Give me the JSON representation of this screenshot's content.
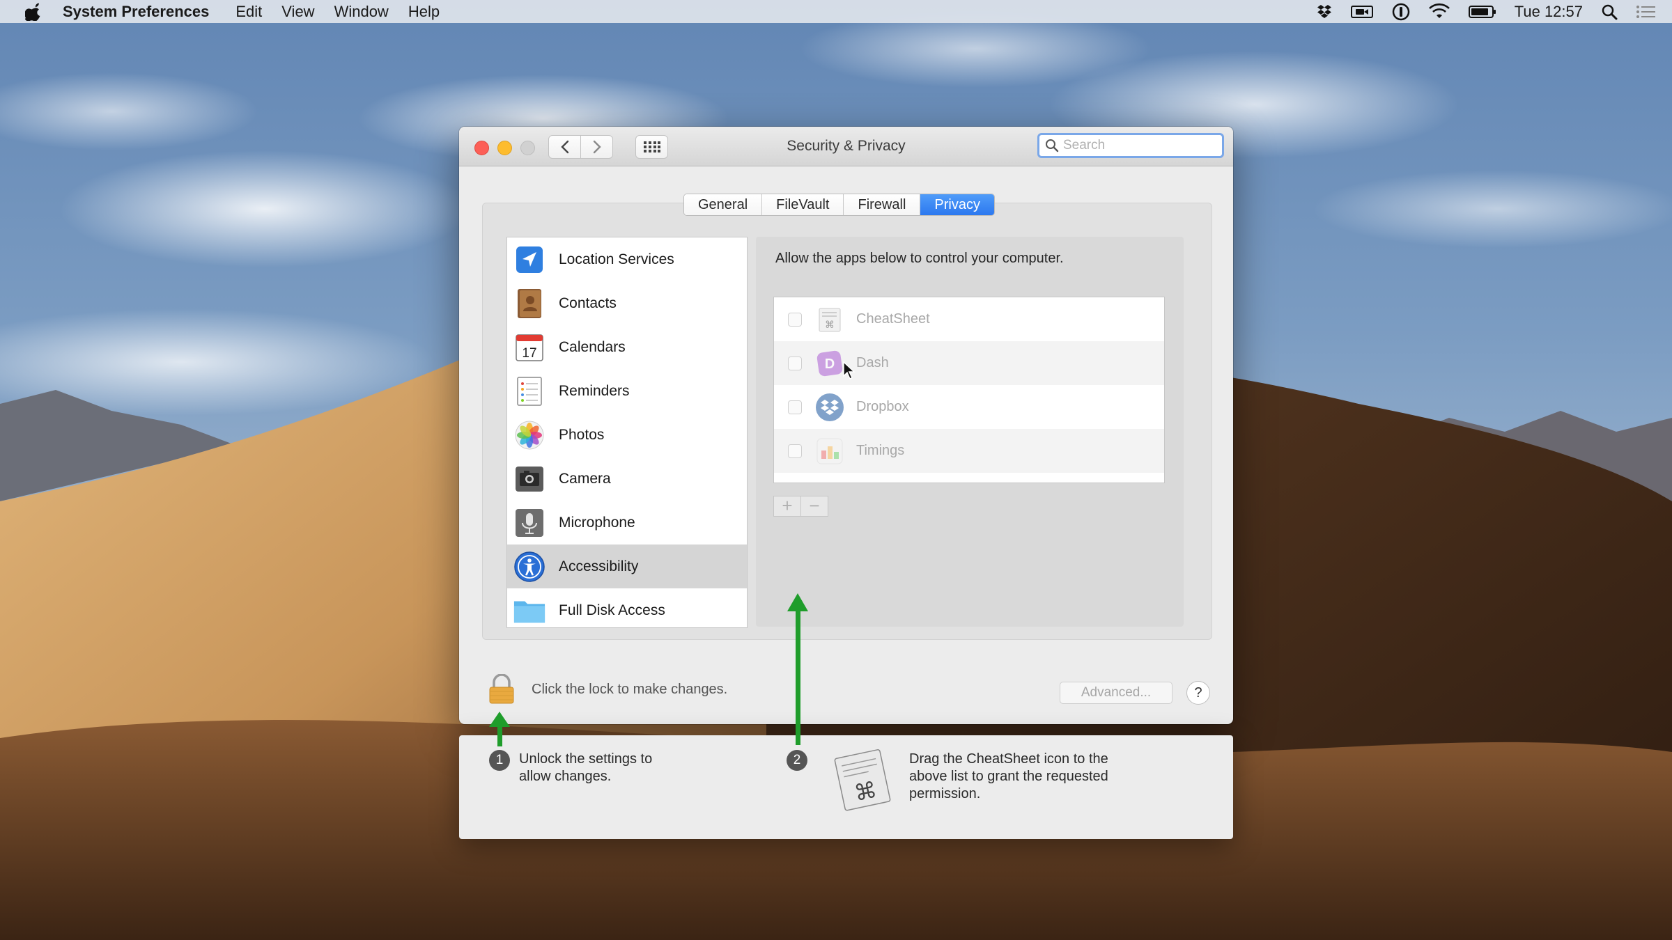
{
  "menubar": {
    "app_name": "System Preferences",
    "items": [
      "Edit",
      "View",
      "Window",
      "Help"
    ],
    "clock": "Tue 12:57",
    "status_icons": [
      "dropbox-icon",
      "facetime-icon",
      "onepassword-icon",
      "wifi-icon",
      "battery-icon",
      "spotlight-icon",
      "notification-center-icon"
    ]
  },
  "window": {
    "title": "Security & Privacy",
    "search_placeholder": "Search",
    "tabs": [
      {
        "label": "General",
        "active": false
      },
      {
        "label": "FileVault",
        "active": false
      },
      {
        "label": "Firewall",
        "active": false
      },
      {
        "label": "Privacy",
        "active": true
      }
    ],
    "privacy_list": [
      {
        "label": "Location Services",
        "icon": "location-icon"
      },
      {
        "label": "Contacts",
        "icon": "contacts-icon"
      },
      {
        "label": "Calendars",
        "icon": "calendar-icon"
      },
      {
        "label": "Reminders",
        "icon": "reminders-icon"
      },
      {
        "label": "Photos",
        "icon": "photos-icon"
      },
      {
        "label": "Camera",
        "icon": "camera-icon"
      },
      {
        "label": "Microphone",
        "icon": "microphone-icon"
      },
      {
        "label": "Accessibility",
        "icon": "accessibility-icon",
        "selected": true
      },
      {
        "label": "Full Disk Access",
        "icon": "folder-icon"
      }
    ],
    "calendar_day": "17",
    "pane_description": "Allow the apps below to control your computer.",
    "apps": [
      {
        "name": "CheatSheet",
        "checked": false,
        "icon": "cheatsheet-icon"
      },
      {
        "name": "Dash",
        "checked": false,
        "icon": "dash-icon"
      },
      {
        "name": "Dropbox",
        "checked": false,
        "icon": "dropbox-icon"
      },
      {
        "name": "Timings",
        "checked": false,
        "icon": "timings-icon"
      }
    ],
    "add_label": "+",
    "remove_label": "−",
    "lock_text": "Click the lock to make changes.",
    "advanced_label": "Advanced...",
    "help_label": "?"
  },
  "instructions": {
    "step1_num": "1",
    "step1_line1": "Unlock the settings to",
    "step1_line2": "allow changes.",
    "step2_num": "2",
    "step2_line1": "Drag the CheatSheet icon to the",
    "step2_line2": "above list to grant the requested",
    "step2_line3": "permission."
  },
  "colors": {
    "accent": "#2c78ef",
    "arrow": "#1f9d2b",
    "close": "#fc5f57",
    "minimize": "#fdbc2e"
  }
}
